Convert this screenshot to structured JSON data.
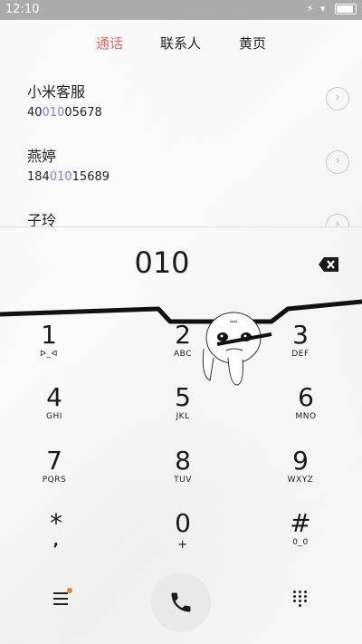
{
  "status_bar": {
    "time": "12:10",
    "icons": "⚡ ▾"
  },
  "tabs": [
    {
      "label": "通话",
      "active": true
    },
    {
      "label": "联系人",
      "active": false
    },
    {
      "label": "黄页",
      "active": false
    }
  ],
  "contacts": [
    {
      "name": "小米客服",
      "number_pre": "40",
      "number_match": "010",
      "number_post": "05678"
    },
    {
      "name": "燕婷",
      "number_pre": "184",
      "number_match": "010",
      "number_post": "15689"
    },
    {
      "name": "子玲",
      "number_pre": "",
      "number_match": "",
      "number_post": ""
    }
  ],
  "dialer": {
    "input": "010"
  },
  "keys": [
    {
      "digit": "1",
      "letters": "ᐅ_ᐊ"
    },
    {
      "digit": "2",
      "letters": "ABC"
    },
    {
      "digit": "3",
      "letters": "DEF"
    },
    {
      "digit": "4",
      "letters": "GHI"
    },
    {
      "digit": "5",
      "letters": "JKL"
    },
    {
      "digit": "6",
      "letters": "MNO"
    },
    {
      "digit": "7",
      "letters": "PQRS"
    },
    {
      "digit": "8",
      "letters": "TUV"
    },
    {
      "digit": "9",
      "letters": "WXYZ"
    },
    {
      "digit": "*",
      "letters": ","
    },
    {
      "digit": "0",
      "letters": "+"
    },
    {
      "digit": "#",
      "letters": "0_0"
    }
  ],
  "colors": {
    "accent": "#f26b5f",
    "match_highlight": "#8c7ee0",
    "notification_dot": "#f08030"
  }
}
